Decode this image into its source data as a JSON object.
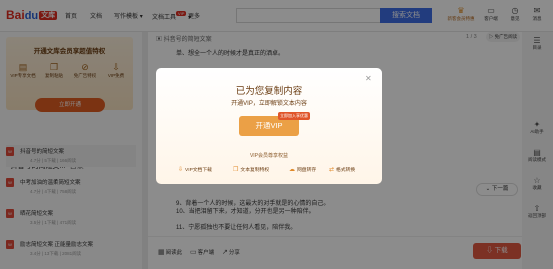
{
  "header": {
    "logo_text": "Bai",
    "logo_paw": "du",
    "logo_tag": "文库",
    "nav": [
      {
        "label": "首页"
      },
      {
        "label": "文档"
      },
      {
        "label": "写作模板"
      },
      {
        "label": "文档工具",
        "tag": "VIP"
      },
      {
        "label": "更多"
      }
    ],
    "search_placeholder": "",
    "search_button": "搜索文档",
    "icons": [
      {
        "label": "新客会员特惠",
        "icon": "vip-crown-icon"
      },
      {
        "label": "客户端",
        "icon": "desktop-client-icon"
      },
      {
        "label": "意见",
        "icon": "feedback-icon"
      },
      {
        "label": "消息",
        "icon": "message-icon"
      }
    ]
  },
  "sidebar": {
    "vip_card_title": "开通文库会员享超值特权",
    "perks": [
      {
        "label": "VIP专享文档",
        "icon": "doc-icon"
      },
      {
        "label": "复制粘贴",
        "icon": "copy-icon"
      },
      {
        "label": "免广告特权",
        "icon": "no-ad-icon"
      },
      {
        "label": "VIP免费",
        "icon": "download-icon"
      }
    ],
    "vip_button": "立即开通",
    "list_header": "\"抖音号的简短文...\"",
    "list_header_dir": "目录",
    "docs": [
      {
        "title": "抖音号的简短文案",
        "meta": "4.7分 | 5下载 | 166阅读",
        "active": true
      },
      {
        "title": "中考加油的温柔简短文案",
        "meta": "4.7分 | 4下载 | 758阅读",
        "active": false
      },
      {
        "title": "晒花简短文案",
        "meta": "3.5分 | 1下载 | 471阅读",
        "active": false
      },
      {
        "title": "励志简短文案 正能量励志文案",
        "meta": "3.4分 | 13下载 | 2081阅读",
        "active": false
      }
    ]
  },
  "document": {
    "title": "抖音号的简短文案",
    "page_indicator": "1 / 3",
    "ad_free_button": "免广告阅读",
    "paragraphs": [
      "单、想全一个人的时候才是真正的洒卓。",
      "9、背着一个人的时候，这最大的对手就是的心情的自己。",
      "10、当把泪留下来，才知道，分开也是另一种陪伴。",
      "11、宁愿孤独也不要让任何人看见，陪伴我。"
    ],
    "actions": [
      {
        "label": "阅读此",
        "icon": "read-icon"
      },
      {
        "label": "客户端",
        "icon": "client-icon"
      },
      {
        "label": "分享",
        "icon": "share-icon"
      }
    ],
    "download_button": "下载"
  },
  "right_rail": [
    {
      "label": "目录",
      "icon": "toc-icon"
    },
    {
      "label": "AI助手",
      "icon": "ai-icon"
    },
    {
      "label": "阅读模式",
      "icon": "read-mode-icon"
    },
    {
      "label": "收藏",
      "icon": "star-icon"
    },
    {
      "label": "返回顶部",
      "icon": "top-icon"
    }
  ],
  "next_page": "下一篇",
  "modal": {
    "title": "已为您复制内容",
    "subtitle": "开通VIP，立即解锁文本内容",
    "button": "开通VIP",
    "badge": "立即加入享优惠",
    "perks_title": "VIP会员尊享权益",
    "perks": [
      {
        "label": "VIP文档下载",
        "icon": "download-icon"
      },
      {
        "label": "文本复制特权",
        "icon": "copy-icon"
      },
      {
        "label": "网盘转存",
        "icon": "cloud-icon"
      },
      {
        "label": "格式转换",
        "icon": "convert-icon"
      }
    ]
  }
}
